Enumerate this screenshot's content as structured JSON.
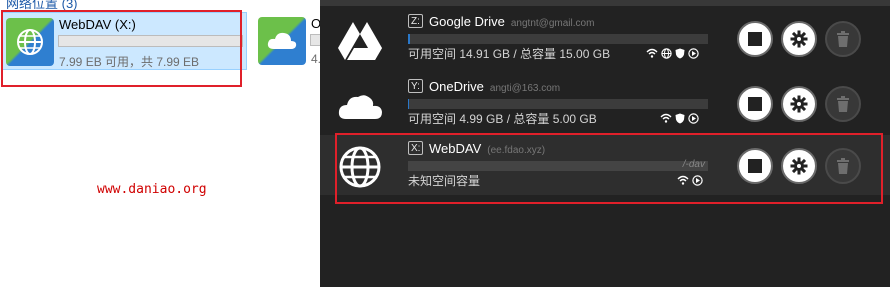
{
  "explorer": {
    "section_header": "网络位置 (3)",
    "drives": [
      {
        "name": "WebDAV (X:)",
        "usage": "7.99 EB 可用，共 7.99 EB",
        "icon": "globe-icon",
        "used_fraction": 0.0
      },
      {
        "name": "O",
        "usage": "4.",
        "icon": "cloud-icon"
      }
    ],
    "watermark": "www.daniao.org"
  },
  "app": {
    "rows": [
      {
        "letter": "Z:",
        "name": "Google Drive",
        "account": "angtnt@gmail.com",
        "status": "可用空间 14.91 GB / 总容量 15.00 GB",
        "bar_label": "",
        "used_fraction": 0.006,
        "icon": "google-drive-icon",
        "flags": [
          "wifi-icon",
          "globe-small-icon",
          "shield-icon",
          "play-circle-icon"
        ]
      },
      {
        "letter": "Y:",
        "name": "OneDrive",
        "account": "angti@163.com",
        "status": "可用空间 4.99 GB / 总容量 5.00 GB",
        "bar_label": "",
        "used_fraction": 0.002,
        "icon": "onedrive-cloud-icon",
        "flags": [
          "wifi-icon",
          "shield-icon",
          "play-circle-icon"
        ]
      },
      {
        "letter": "X:",
        "name": "WebDAV",
        "account": "(ee.fdao.xyz)",
        "status": "未知空间容量",
        "bar_label": "/-dav",
        "used_fraction": 0.0,
        "icon": "webdav-globe-icon",
        "flags": [
          "wifi-icon",
          "play-circle-icon"
        ]
      }
    ],
    "colors": {
      "accent": "#2a78c9",
      "panel_bg": "#222222",
      "highlight": "#e0202a"
    }
  }
}
